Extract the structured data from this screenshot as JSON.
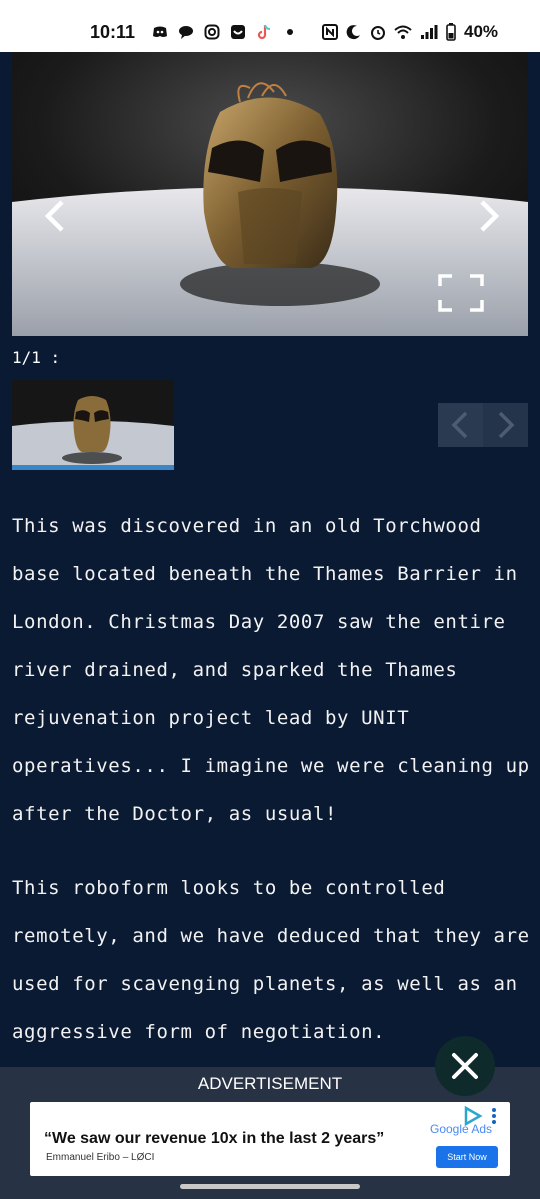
{
  "status_bar": {
    "time": "10:11",
    "battery": "40%",
    "left_icons": [
      "discord-icon",
      "chat-icon",
      "instagram-icon",
      "app-icon",
      "tiktok-icon",
      "dot-icon"
    ],
    "right_icons": [
      "nfc-icon",
      "moon-icon",
      "alarm-icon",
      "wifi-icon",
      "signal-icon",
      "battery-icon"
    ]
  },
  "gallery": {
    "counter": "1/1 :",
    "image_subject": "bronze robot mask"
  },
  "article": {
    "paragraphs": [
      "This was discovered in an old Torchwood base located beneath the Thames Barrier in London. Christmas Day 2007 saw the entire river drained, and sparked the Thames rejuvenation project lead by UNIT operatives... I imagine we were cleaning up after the Doctor, as usual!",
      "This roboform looks to be controlled remotely, and we have deduced that they are used for scavenging planets, as well as an aggressive form of negotiation."
    ]
  },
  "ad": {
    "label": "ADVERTISEMENT",
    "quote": "“We saw our revenue 10x in the last 2 years”",
    "author": "Emmanuel Eribo – LØCI",
    "brand": "Google Ads",
    "cta": "Start Now"
  }
}
